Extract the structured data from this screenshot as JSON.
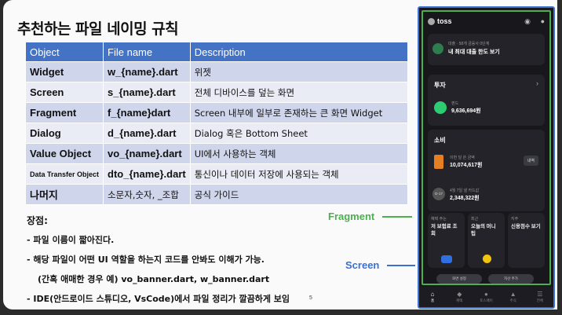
{
  "slide": {
    "title": "추천하는 파일 네이밍 규칙",
    "table": {
      "headers": [
        "Object",
        "File name",
        "Description"
      ],
      "rows": [
        [
          "Widget",
          "w_{name}.dart",
          "위젯"
        ],
        [
          "Screen",
          "s_{name}.dart",
          "전체 디바이스를 덮는 화면"
        ],
        [
          "Fragment",
          "f_{name}dart",
          "Screen 내부에 일부로 존재하는 큰 화면 Widget"
        ],
        [
          "Dialog",
          "d_{name}.dart",
          "Dialog 혹은 Bottom Sheet"
        ],
        [
          "Value Object",
          "vo_{name}.dart",
          "UI에서 사용하는 객체"
        ],
        [
          "Data Transfer Object",
          "dto_{name}.dart",
          "통신이나 데이터 저장에 사용되는 객체"
        ],
        [
          "나머지",
          "소문자,숫자, _조합",
          "공식 가이드"
        ]
      ]
    },
    "notes": {
      "heading": "장점:",
      "lines": [
        "-  파일 이름이 짧아진다.",
        "-  해당 파일이 어떤 UI 역할을 하는지 코드를 안봐도 이해가 가능.",
        "(간혹 애매한 경우 예) vo_banner.dart, w_banner.dart",
        "-  IDE(안드로이드 스튜디오, VsCode)에서 파일 정리가 깔끔하게 보임"
      ]
    },
    "page_number": "5",
    "labels": {
      "fragment": "Fragment",
      "screen": "Screen"
    }
  },
  "phone": {
    "app_name": "toss",
    "loan_card": {
      "caption": "대출 · 58개 금융사 0단계",
      "title": "내 최대 대출 한도 보기"
    },
    "invest": {
      "title": "투자",
      "caption": "펀드",
      "amount": "9,636,694원"
    },
    "spend": {
      "title": "소비",
      "item1_caption": "이번 달 쓴 금액",
      "item1_amount": "10,074,617원",
      "item1_button": "내역",
      "item2_badge": "D-17",
      "item2_caption": "4월 7일 낼 카드값",
      "item2_amount": "2,348,322원"
    },
    "tiles": [
      {
        "caption": "혜택 주는",
        "title": "저 보험료 조회"
      },
      {
        "caption": "최근",
        "title": "오늘의 머니 팁"
      },
      {
        "caption": "지주",
        "title": "신용점수 보기"
      }
    ],
    "pills": [
      "화면 설정",
      "자산 추가"
    ],
    "tabs": [
      "홈",
      "혜택",
      "토스페이",
      "주식",
      "전체"
    ],
    "colors": {
      "accent_green": "#4caf50",
      "screen_blue": "#3b6fd4",
      "table_header": "#4472c4"
    }
  }
}
